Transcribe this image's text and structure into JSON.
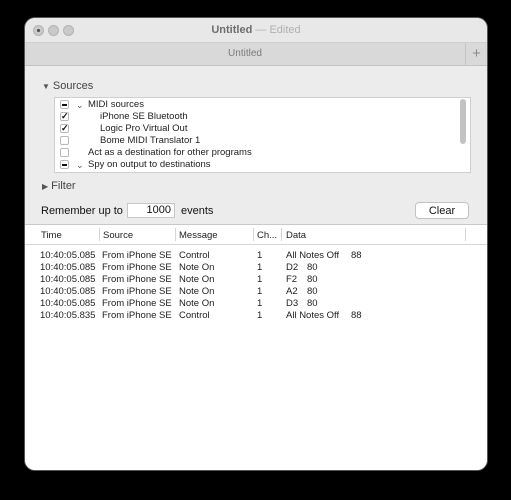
{
  "window": {
    "title": "Untitled",
    "title_sep": "—",
    "edited": "Edited",
    "tab_label": "Untitled",
    "tab_add": "+"
  },
  "sources": {
    "label": "Sources",
    "rows": [
      {
        "label": "MIDI sources",
        "state": "mixed",
        "expandable": true
      },
      {
        "label": "iPhone SE Bluetooth",
        "state": "checked"
      },
      {
        "label": "Logic Pro Virtual Out",
        "state": "checked"
      },
      {
        "label": "Bome MIDI Translator 1",
        "state": "unchecked"
      },
      {
        "label": "Act as a destination for other programs",
        "state": "unchecked"
      },
      {
        "label": "Spy on output to destinations",
        "state": "mixed",
        "expandable": true
      }
    ]
  },
  "filter": {
    "label": "Filter"
  },
  "history": {
    "remember_label": "Remember up to",
    "count": "1000",
    "events_label": "events",
    "clear_label": "Clear"
  },
  "table": {
    "columns": [
      "Time",
      "Source",
      "Message",
      "Ch...",
      "Data"
    ],
    "rows": [
      {
        "time": "10:40:05.085",
        "source": "From iPhone SE B",
        "message": "Control",
        "ch": "1",
        "data1": "All Notes Off",
        "data2": "88"
      },
      {
        "time": "10:40:05.085",
        "source": "From iPhone SE B",
        "message": "Note On",
        "ch": "1",
        "data1": "D2",
        "data2": "80"
      },
      {
        "time": "10:40:05.085",
        "source": "From iPhone SE B",
        "message": "Note On",
        "ch": "1",
        "data1": "F2",
        "data2": "80"
      },
      {
        "time": "10:40:05.085",
        "source": "From iPhone SE B",
        "message": "Note On",
        "ch": "1",
        "data1": "A2",
        "data2": "80"
      },
      {
        "time": "10:40:05.085",
        "source": "From iPhone SE B",
        "message": "Note On",
        "ch": "1",
        "data1": "D3",
        "data2": "80"
      },
      {
        "time": "10:40:05.835",
        "source": "From iPhone SE B",
        "message": "Control",
        "ch": "1",
        "data1": "All Notes Off",
        "data2": "88"
      }
    ]
  }
}
